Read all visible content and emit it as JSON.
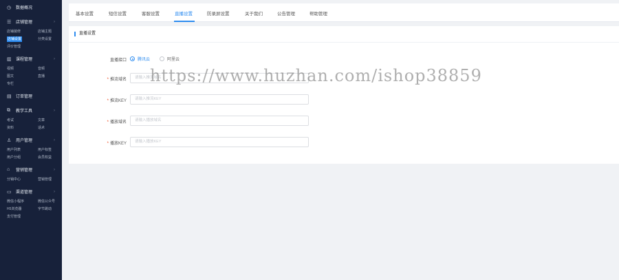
{
  "sidebar": {
    "dashboard": {
      "icon": "clock-icon",
      "label": "数据概况"
    },
    "groups": [
      {
        "icon": "store-icon",
        "label": "店铺管理",
        "items": [
          [
            "店铺装修",
            "店铺主题"
          ],
          [
            "店铺设置",
            "分类设置"
          ],
          [
            "评价管理"
          ]
        ]
      },
      {
        "icon": "book-icon",
        "label": "课程管理",
        "items": [
          [
            "视频",
            "音频"
          ],
          [
            "图文",
            "直播"
          ],
          [
            "专栏"
          ]
        ]
      },
      {
        "icon": "order-icon",
        "label": "订单管理",
        "items": []
      },
      {
        "icon": "tools-icon",
        "label": "教学工具",
        "items": [
          [
            "考试",
            "文章"
          ],
          [
            "资料",
            "话术"
          ]
        ]
      },
      {
        "icon": "user-icon",
        "label": "用户管理",
        "items": [
          [
            "用户列表",
            "用户标签"
          ],
          [
            "用户分组",
            "会员权益"
          ]
        ]
      },
      {
        "icon": "shop-icon",
        "label": "营销管理",
        "items": [
          [
            "分销中心",
            "营销管理"
          ]
        ]
      },
      {
        "icon": "monitor-icon",
        "label": "渠道管理",
        "items": [
          [
            "微信小程序",
            "微信公众号"
          ],
          [
            "H5浏览器",
            "字节跳动"
          ],
          [
            "支付管理"
          ]
        ]
      }
    ],
    "active_item": "店铺设置"
  },
  "tabs": [
    "基本设置",
    "短信设置",
    "客服设置",
    "直播设置",
    "防录屏设置",
    "关于我们",
    "公告管理",
    "帮助管理"
  ],
  "active_tab": "直播设置",
  "panel": {
    "title": "直播设置",
    "fields": {
      "interface": {
        "label": "直播接口",
        "options": [
          "腾讯云",
          "阿里云"
        ],
        "selected": "腾讯云"
      },
      "push_url": {
        "label": "推流域名",
        "required": "*",
        "placeholder": "请输入推流域名"
      },
      "push_key": {
        "label": "推流KEY",
        "required": "*",
        "placeholder": "请输入推流KEY"
      },
      "play_url": {
        "label": "播放域名",
        "required": "*",
        "placeholder": "请输入播放域名"
      },
      "play_key": {
        "label": "播放KEY",
        "required": "*",
        "placeholder": "请输入播放KEY"
      }
    }
  },
  "watermark": "https://www.huzhan.com/ishop38859",
  "colors": {
    "sidebar_bg": "#17213a",
    "accent": "#2d8cf0",
    "required": "#ed4014"
  }
}
